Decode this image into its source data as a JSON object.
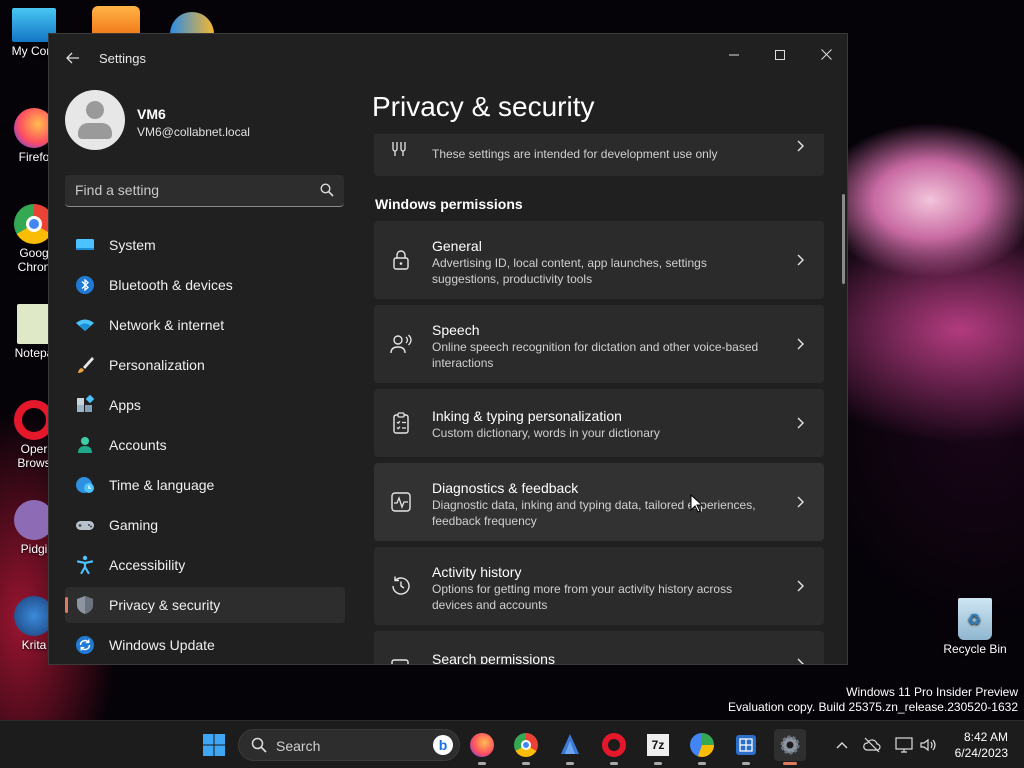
{
  "desktop": {
    "icons": [
      {
        "label": "My Com"
      },
      {
        "label": "Firefo"
      },
      {
        "label": "Goog Chron"
      },
      {
        "label": "Notepa"
      },
      {
        "label": "Oper Brows"
      },
      {
        "label": "Pidgi"
      },
      {
        "label": "Krita"
      },
      {
        "label": "Recycle Bin"
      }
    ],
    "watermark": {
      "line1": "Windows 11 Pro Insider Preview",
      "line2": "Evaluation copy. Build 25375.zn_release.230520-1632"
    }
  },
  "window": {
    "title": "Settings",
    "controls": {
      "minimize": "–",
      "maximize": "☐",
      "close": "✕"
    }
  },
  "profile": {
    "name": "VM6",
    "email": "VM6@collabnet.local"
  },
  "search": {
    "placeholder": "Find a setting"
  },
  "nav": {
    "items": [
      {
        "label": "System",
        "icon": "system-icon"
      },
      {
        "label": "Bluetooth & devices",
        "icon": "bluetooth-icon"
      },
      {
        "label": "Network & internet",
        "icon": "wifi-icon"
      },
      {
        "label": "Personalization",
        "icon": "brush-icon"
      },
      {
        "label": "Apps",
        "icon": "apps-icon"
      },
      {
        "label": "Accounts",
        "icon": "person-icon"
      },
      {
        "label": "Time & language",
        "icon": "globe-clock-icon"
      },
      {
        "label": "Gaming",
        "icon": "gamepad-icon"
      },
      {
        "label": "Accessibility",
        "icon": "accessibility-icon"
      },
      {
        "label": "Privacy & security",
        "icon": "shield-icon",
        "active": true
      },
      {
        "label": "Windows Update",
        "icon": "update-icon"
      }
    ]
  },
  "main": {
    "title": "Privacy & security",
    "top_card_desc": "These settings are intended for development use only",
    "section_label": "Windows permissions",
    "cards": [
      {
        "title": "General",
        "desc": "Advertising ID, local content, app launches, settings suggestions, productivity tools",
        "icon": "lock-icon"
      },
      {
        "title": "Speech",
        "desc": "Online speech recognition for dictation and other voice-based interactions",
        "icon": "speech-icon"
      },
      {
        "title": "Inking & typing personalization",
        "desc": "Custom dictionary, words in your dictionary",
        "icon": "clipboard-list-icon"
      },
      {
        "title": "Diagnostics & feedback",
        "desc": "Diagnostic data, inking and typing data, tailored experiences, feedback frequency",
        "icon": "pulse-icon"
      },
      {
        "title": "Activity history",
        "desc": "Options for getting more from your activity history across devices and accounts",
        "icon": "history-icon"
      },
      {
        "title": "Search permissions",
        "desc": "",
        "icon": "search-permissions-icon"
      }
    ]
  },
  "taskbar": {
    "search_label": "Search",
    "time": "8:42 AM",
    "date": "6/24/2023"
  },
  "colors": {
    "accent": "#e07a5f",
    "window_bg": "#202020",
    "card_bg": "#2b2b2b"
  }
}
